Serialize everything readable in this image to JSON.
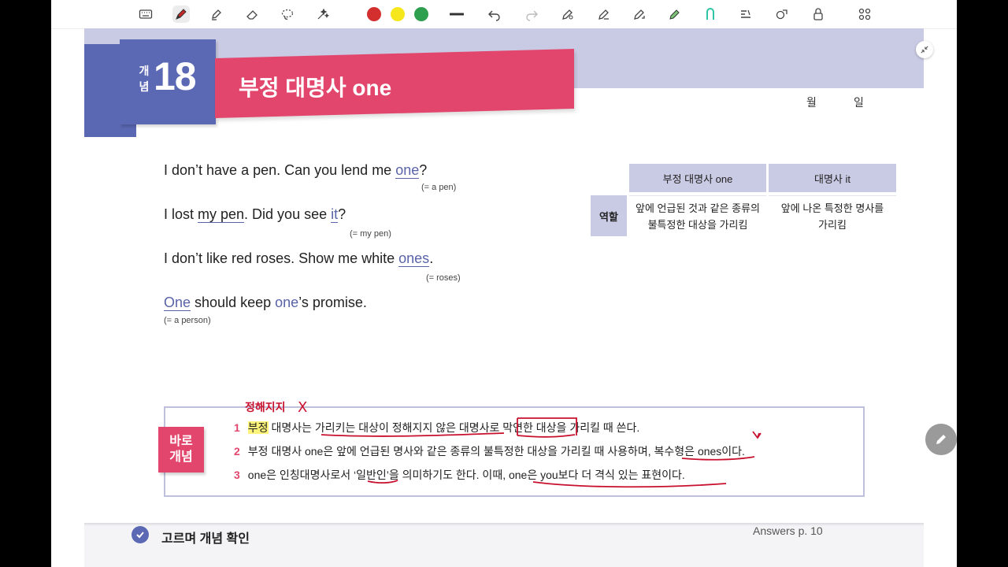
{
  "toolbar": {
    "tools": [
      "keyboard-icon",
      "pen-icon",
      "highlighter-icon",
      "eraser-icon",
      "lasso-icon",
      "magic-icon"
    ],
    "colors": {
      "red": "#d32f2f",
      "yellow": "#f6e71d",
      "green": "#2e9e4f"
    },
    "actions": [
      "undo-icon",
      "redo-icon",
      "pen-settings-icon",
      "shape-pen-icon",
      "tape-icon",
      "green-pen-icon",
      "stroke-icon",
      "text-icon",
      "shapes-icon",
      "lock-icon",
      "grid-icon"
    ]
  },
  "header": {
    "concept_small_1": "개",
    "concept_small_2": "념",
    "concept_number": "18",
    "title": "부정 대명사 one",
    "month_label": "월",
    "day_label": "일"
  },
  "examples": [
    {
      "pre": "I don’t have a pen. Can you lend me ",
      "key": "one",
      "post": "?",
      "note": "(= a pen)"
    },
    {
      "pre1": "I lost ",
      "mid": "my pen",
      "pre2": ". Did you see ",
      "key": "it",
      "post": "?",
      "note": "(= my pen)"
    },
    {
      "pre": "I don’t like red roses. Show me white ",
      "key": "ones",
      "post": ".",
      "note": "(= roses)"
    },
    {
      "key1": "One",
      "mid": " should keep ",
      "key2": "one",
      "post": "’s promise.",
      "note": "(= a person)"
    }
  ],
  "table": {
    "col1_header": "부정 대명사 one",
    "col2_header": "대명사 it",
    "row_label": "역할",
    "col1_line1": "앞에 언급된 것과 같은 종류의",
    "col1_line2": "불특정한 대상을 가리킴",
    "col2_line1": "앞에 나온 특정한 명사를",
    "col2_line2": "가리킴"
  },
  "concept_box": {
    "tag_line1": "바로",
    "tag_line2": "개념",
    "items": [
      {
        "num": "1",
        "marked": "부정",
        "text": " 대명사는 가리키는 대상이 정해지지 않은 대명사로 막연한 대상을 가리킬 때 쓴다."
      },
      {
        "num": "2",
        "text": "부정 대명사 one은 앞에 언급된 명사와 같은 종류의 불특정한 대상을 가리킬 때 사용하며, 복수형은 ones이다."
      },
      {
        "num": "3",
        "text": "one은 인칭대명사로서 ‘일반인’을 의미하기도 한다. 이때, one은 you보다 더 격식 있는 표현이다."
      }
    ]
  },
  "handwriting": {
    "note": "정해지지",
    "mark": "X"
  },
  "footer": {
    "section_title": "고르며 개념 확인",
    "answers": "Answers p. 10"
  }
}
